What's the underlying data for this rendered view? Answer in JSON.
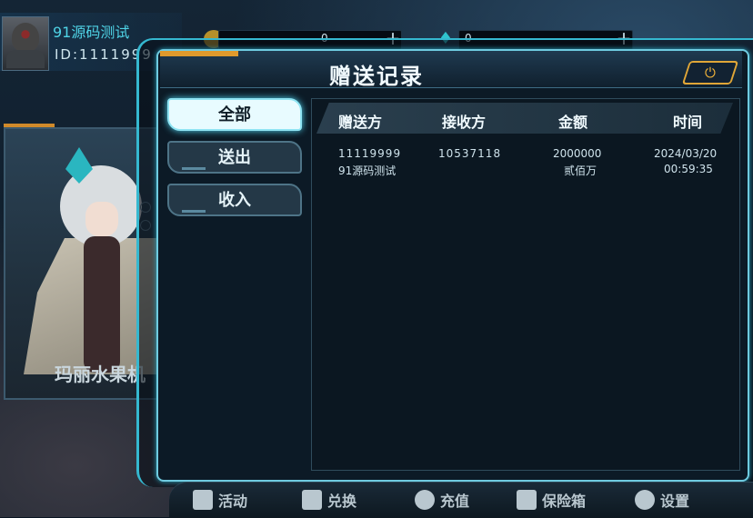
{
  "player": {
    "name": "91源码测试",
    "id_label": "ID:1111999"
  },
  "currency": {
    "gold_value": "0",
    "gem_value": "0",
    "plus_glyph": "+"
  },
  "character": {
    "name": "玛丽水果机"
  },
  "dialog": {
    "title": "赠送记录",
    "close_icon_glyph": "⏻"
  },
  "tabs": [
    {
      "label": "全部",
      "active": true
    },
    {
      "label": "送出",
      "active": false
    },
    {
      "label": "收入",
      "active": false
    }
  ],
  "table": {
    "headers": [
      "赠送方",
      "接收方",
      "金额",
      "时间"
    ],
    "rows": [
      {
        "sender_id": "11119999",
        "sender_name": "91源码测试",
        "receiver": "10537118",
        "amount": "2000000",
        "amount_text": "贰佰万",
        "date": "2024/03/20",
        "time": "00:59:35"
      }
    ]
  },
  "bottom_nav": [
    {
      "label": "活动",
      "icon": "activity-icon"
    },
    {
      "label": "兑换",
      "icon": "gift-icon"
    },
    {
      "label": "充值",
      "icon": "yen-icon"
    },
    {
      "label": "保险箱",
      "icon": "briefcase-icon"
    },
    {
      "label": "设置",
      "icon": "gear-icon"
    }
  ],
  "colors": {
    "accent_cyan": "#6fcbe0",
    "accent_orange": "#e09a2c",
    "name_cyan": "#4fd3e6"
  }
}
